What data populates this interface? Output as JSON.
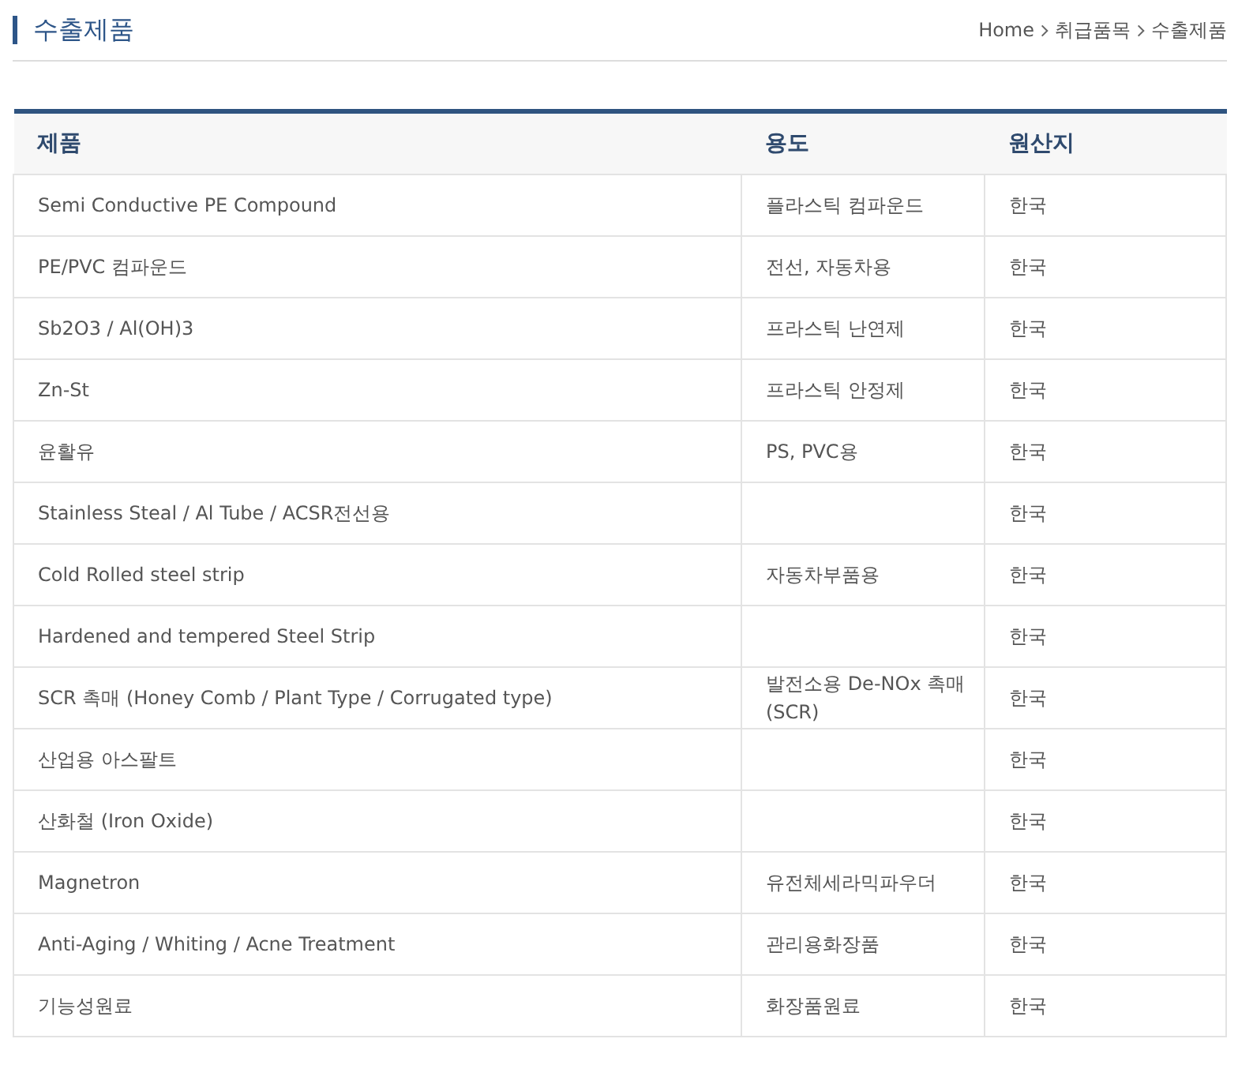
{
  "page_title": "수출제품",
  "breadcrumb": [
    "Home",
    "취급품목",
    "수출제품"
  ],
  "table": {
    "columns": [
      "제품",
      "용도",
      "원산지"
    ],
    "rows": [
      [
        "Semi Conductive PE Compound",
        "플라스틱 컴파운드",
        "한국"
      ],
      [
        "PE/PVC 컴파운드",
        "전선, 자동차용",
        "한국"
      ],
      [
        "Sb2O3 / Al(OH)3",
        "프라스틱 난연제",
        "한국"
      ],
      [
        "Zn-St",
        "프라스틱 안정제",
        "한국"
      ],
      [
        "윤활유",
        "PS, PVC용",
        "한국"
      ],
      [
        "Stainless Steal / Al Tube / ACSR전선용",
        "",
        "한국"
      ],
      [
        "Cold Rolled steel strip",
        "자동차부품용",
        "한국"
      ],
      [
        "Hardened and tempered Steel Strip",
        "",
        "한국"
      ],
      [
        "SCR 촉매 (Honey Comb / Plant Type / Corrugated type)",
        "발전소용 De-NOx 촉매 (SCR)",
        "한국"
      ],
      [
        "산업용 아스팔트",
        "",
        "한국"
      ],
      [
        "산화철 (Iron Oxide)",
        "",
        "한국"
      ],
      [
        "Magnetron",
        "유전체세라믹파우더",
        "한국"
      ],
      [
        "Anti-Aging / Whiting / Acne Treatment",
        "관리용화장품",
        "한국"
      ],
      [
        "기능성원료",
        "화장품원료",
        "한국"
      ]
    ]
  }
}
